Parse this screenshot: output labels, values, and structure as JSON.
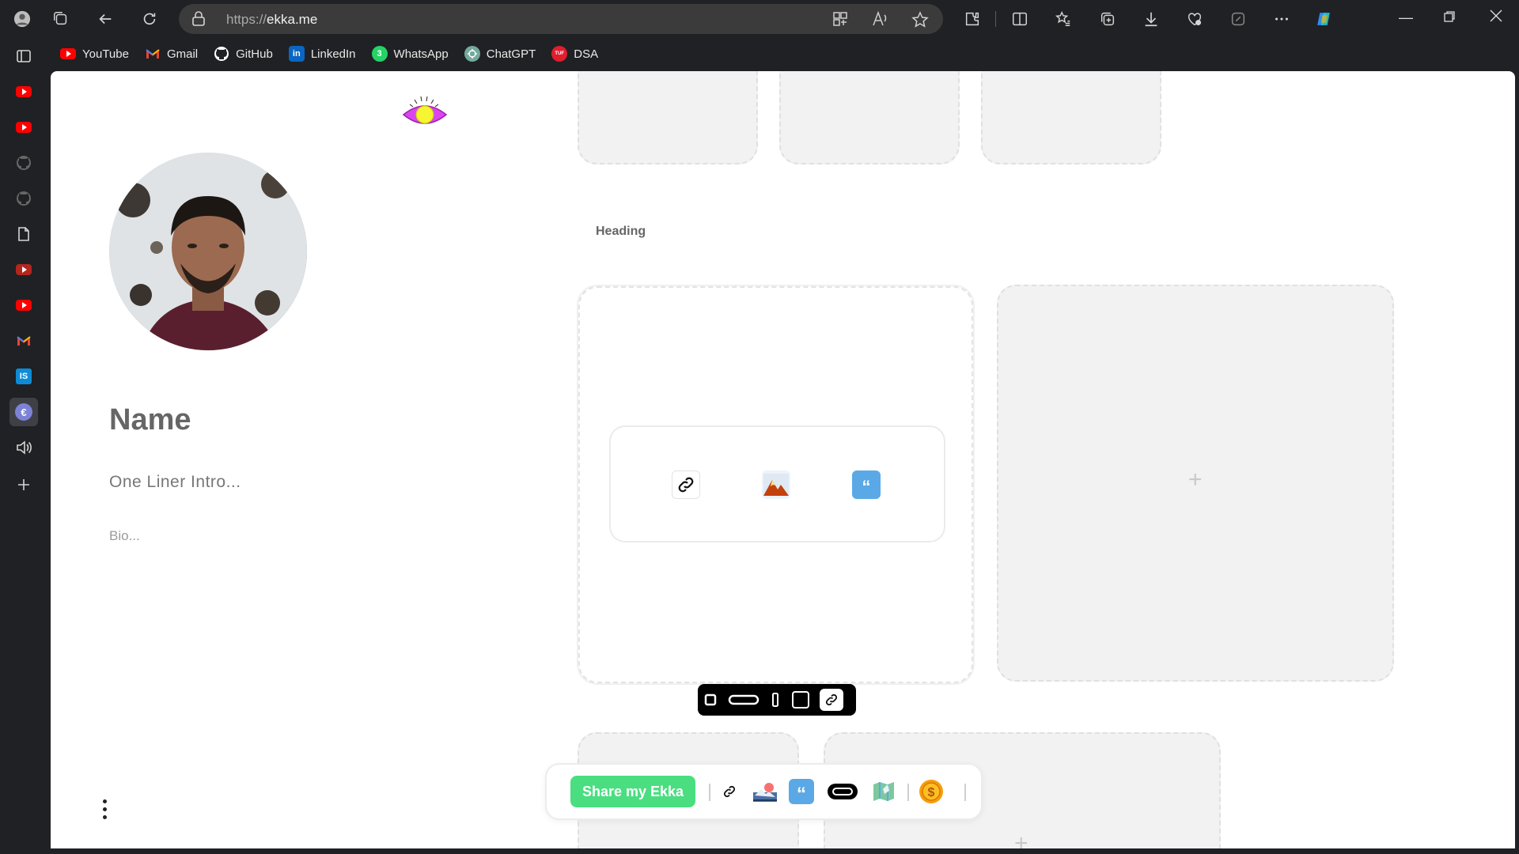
{
  "browser": {
    "url_prefix": "https://",
    "url_host": "ekka.me"
  },
  "bookmarks": [
    {
      "label": "YouTube",
      "icon": "youtube-icon",
      "color": "#ff0000"
    },
    {
      "label": "Gmail",
      "icon": "gmail-icon",
      "color": "#ea4335"
    },
    {
      "label": "GitHub",
      "icon": "github-icon",
      "color": "#ffffff"
    },
    {
      "label": "LinkedIn",
      "icon": "linkedin-icon",
      "color": "#0a66c2"
    },
    {
      "label": "WhatsApp",
      "icon": "whatsapp-icon",
      "color": "#25d366"
    },
    {
      "label": "ChatGPT",
      "icon": "chatgpt-icon",
      "color": "#74aa9c"
    },
    {
      "label": "DSA",
      "icon": "dsa-icon",
      "color": "#e11d2e"
    }
  ],
  "sidebar_icons": [
    "tabs-icon",
    "youtube-icon",
    "youtube-icon",
    "github-icon",
    "github-icon",
    "document-icon",
    "youtube-icon",
    "youtube-icon",
    "gmail-icon",
    "is-icon",
    "ekka-icon",
    "speaker-icon",
    "plus-icon"
  ],
  "sidebar_is_label": "IS",
  "profile": {
    "name": "Name",
    "one_liner": "One Liner Intro...",
    "bio": "Bio..."
  },
  "section": {
    "heading": "Heading"
  },
  "tiles": {
    "plus": "+"
  },
  "bottom_bar": {
    "share_label": "Share my Ekka"
  },
  "colors": {
    "accent_green": "#4ade80",
    "tile_bg": "#f2f2f2",
    "text_gray": "#666666"
  }
}
